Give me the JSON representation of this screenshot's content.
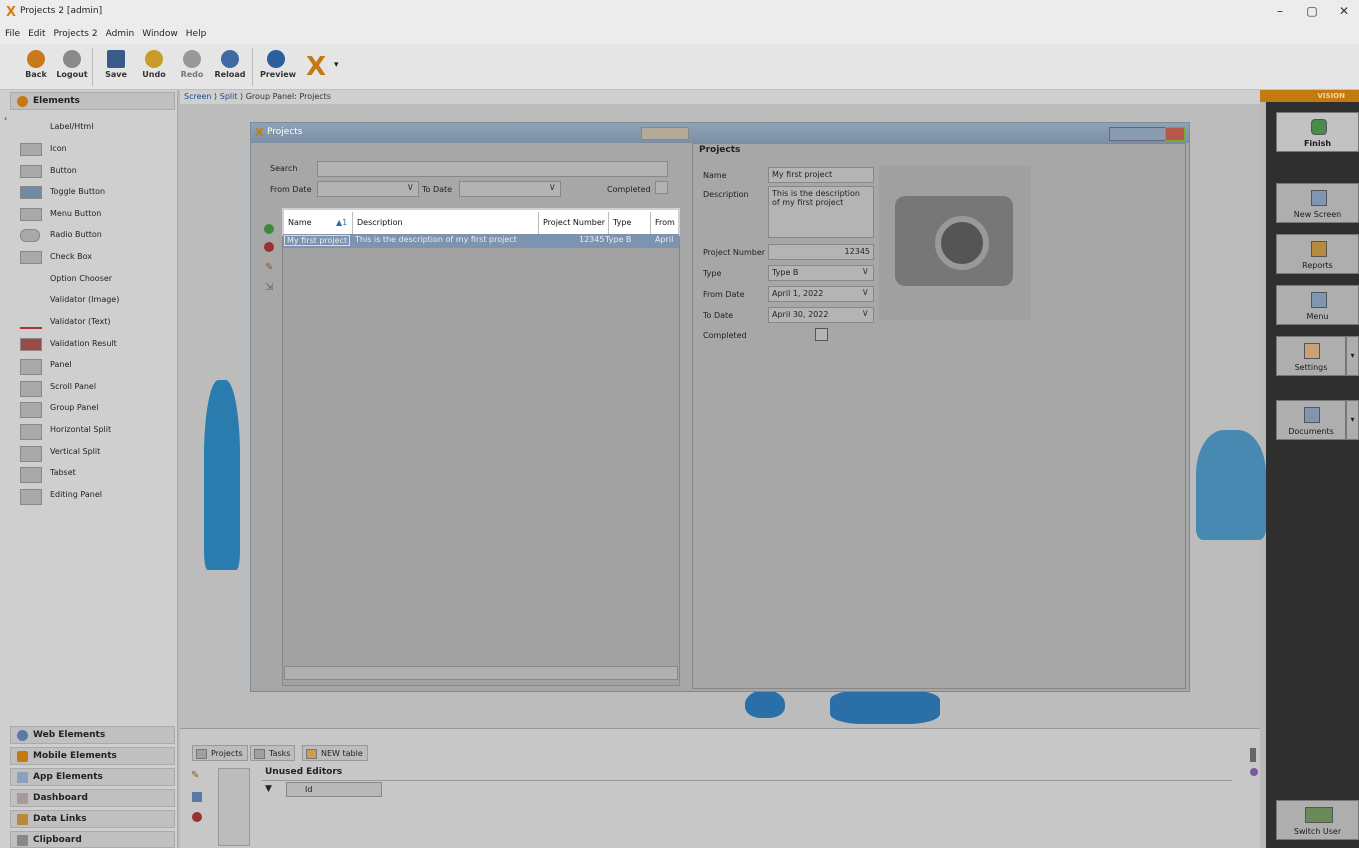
{
  "window": {
    "title": "Projects 2 [admin]"
  },
  "menu": [
    "File",
    "Edit",
    "Projects 2",
    "Admin",
    "Window",
    "Help"
  ],
  "toolbar": {
    "back": "Back",
    "logout": "Logout",
    "save": "Save",
    "undo": "Undo",
    "redo": "Redo",
    "reload": "Reload",
    "preview": "Preview"
  },
  "palette": {
    "header": "Elements",
    "items": [
      "Label/Html",
      "Icon",
      "Button",
      "Toggle Button",
      "Menu Button",
      "Radio Button",
      "Check Box",
      "Option Chooser",
      "Validator (Image)",
      "Validator (Text)",
      "Validation Result",
      "Panel",
      "Scroll Panel",
      "Group Panel",
      "Horizontal Split",
      "Vertical Split",
      "Tabset",
      "Editing Panel"
    ],
    "sections": [
      "Web Elements",
      "Mobile Elements",
      "App Elements",
      "Dashboard",
      "Data Links",
      "Clipboard"
    ]
  },
  "breadcrumb": {
    "screen": "Screen",
    "split": "Split",
    "current": "Group Panel: Projects"
  },
  "projects_window": {
    "title": "Projects",
    "search_label": "Search",
    "from_date_label": "From Date",
    "to_date_label": "To Date",
    "completed_label": "Completed",
    "grid": {
      "columns": [
        "Name",
        "Description",
        "Project Number",
        "Type",
        "From"
      ],
      "sort_indicator": "▲1",
      "row": [
        "My first project",
        "This is the description of my first project",
        "12345",
        "Type B",
        "April"
      ]
    }
  },
  "detail": {
    "title": "Projects",
    "name_label": "Name",
    "name_value": "My first project",
    "description_label": "Description",
    "description_value": "This is the description of my first project",
    "project_number_label": "Project Number",
    "project_number_value": "12345",
    "type_label": "Type",
    "type_value": "Type B",
    "from_date_label": "From Date",
    "from_date_value": "April 1, 2022",
    "to_date_label": "To Date",
    "to_date_value": "April 30, 2022",
    "completed_label": "Completed"
  },
  "right_bar": {
    "vision": "VISION",
    "finish": "Finish",
    "new_screen": "New Screen",
    "reports": "Reports",
    "menu": "Menu",
    "settings": "Settings",
    "documents": "Documents",
    "switch_user": "Switch User"
  },
  "bottom": {
    "tabs": [
      "Projects",
      "Tasks",
      "NEW table"
    ],
    "unused_editors": "Unused Editors",
    "field": "Id"
  },
  "colors": {
    "accent": "#c37a10",
    "selection": "#7c94b0",
    "sidebar": "#2f2f2f"
  }
}
